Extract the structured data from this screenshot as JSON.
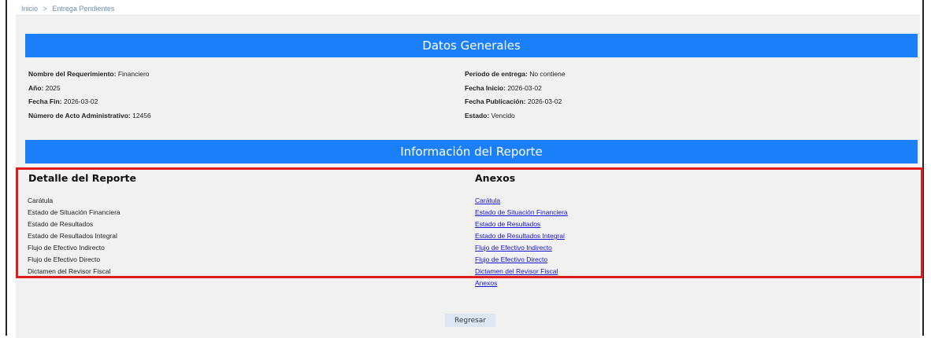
{
  "breadcrumb": {
    "home": "Inicio",
    "sep": ">",
    "current": "Entrega Pendientes"
  },
  "general": {
    "title": "Datos Generales",
    "left": [
      {
        "label": "Nombre del Requerimiento:",
        "value": " Financiero"
      },
      {
        "label": "Año:",
        "value": " 2025"
      },
      {
        "label": "Fecha Fin:",
        "value": " 2026-03-02"
      },
      {
        "label": "Número de Acto Administrativo:",
        "value": " 12456"
      }
    ],
    "right": [
      {
        "label": "Periodo de entrega:",
        "value": " No contiene"
      },
      {
        "label": "Fecha Inicio:",
        "value": " 2026-03-02"
      },
      {
        "label": "Fecha Publicación:",
        "value": " 2026-03-02"
      },
      {
        "label": "Estado:",
        "value": " Vencido"
      }
    ]
  },
  "report": {
    "title": "Información del Reporte",
    "detail_title": "Detalle del Reporte",
    "detail_items": [
      "Carátula",
      "Estado de Situación Financiera",
      "Estado de Resultados",
      "Estado de Resultados Integral",
      "Flujo de Efectivo Indirecto",
      "Flujo de Efectivo Directo",
      "Dictamen del Revisor Fiscal"
    ],
    "anexos_title": "Anexos",
    "anexos_links": [
      "Carátula",
      "Estado de Situación Financiera",
      "Estado de Resultados",
      "Estado de Resultados Integral",
      "Flujo de Efectivo Indirecto",
      "Flujo de Efectivo Directo",
      "Dictamen del Revisor Fiscal",
      "Anexos"
    ]
  },
  "actions": {
    "back_label": "Regresar"
  },
  "colors": {
    "header_bar": "#1a7ff8",
    "highlight": "#e01b1b",
    "link": "#1414d2"
  }
}
